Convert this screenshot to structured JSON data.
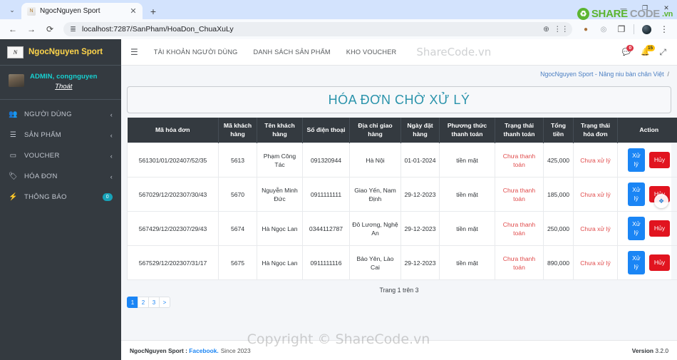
{
  "browser": {
    "tab_title": "NgocNguyen Sport",
    "tab_close": "✕",
    "new_tab": "+",
    "tab_list": "⌄",
    "back": "←",
    "forward": "→",
    "reload": "⟳",
    "url": "localhost:7287/SanPham/HoaDon_ChuaXuLy",
    "site_info_icon": "≣",
    "zoom_icon": "⊕",
    "split_icon": "⋮⋮",
    "cookie_icon": "●",
    "extension_icon": "◌",
    "sidepanel_icon": "❐",
    "menu_icon": "⋮",
    "min": "—",
    "max": "❐",
    "close": "✕"
  },
  "watermark": {
    "logo_glyph": "♻",
    "share": "SHARE",
    "code": "CODE",
    "vn": ".vn",
    "nav_text": "ShareCode.vn",
    "copyright": "Copyright © ShareCode.vn"
  },
  "sidebar": {
    "brand": "NgocNguyen Sport",
    "brand_logo_text": "N",
    "user": {
      "name": "ADMIN, congnguyen",
      "logout": "Thoát"
    },
    "items": [
      {
        "label": "NGƯỜI DÙNG",
        "icon": "👥",
        "chevron": "‹",
        "badge": null
      },
      {
        "label": "SẢN PHẨM",
        "icon": "☰",
        "chevron": "‹",
        "badge": null
      },
      {
        "label": "VOUCHER",
        "icon": "▭",
        "chevron": "‹",
        "badge": null
      },
      {
        "label": "HÓA ĐƠN",
        "icon": "🏷",
        "chevron": "‹",
        "badge": null
      },
      {
        "label": "THÔNG BÁO",
        "icon": "⚡",
        "chevron": null,
        "badge": "0"
      }
    ]
  },
  "navbar": {
    "hamburger": "☰",
    "links": [
      "TÀI KHOẢN NGƯỜI DÙNG",
      "DANH SÁCH SẢN PHẨM",
      "KHO VOUCHER"
    ],
    "chat_icon": "💬",
    "chat_badge": "0",
    "bell_icon": "🔔",
    "bell_badge": "15",
    "expand_icon": "⤢"
  },
  "breadcrumb": {
    "text": "NgocNguyen Sport - Nâng niu bàn chân Việt",
    "separator": "/"
  },
  "page": {
    "title": "HÓA ĐƠN CHỜ XỬ LÝ"
  },
  "table": {
    "columns": [
      "Mã hóa đơn",
      "Mã khách hàng",
      "Tên khách hàng",
      "Số điện thoại",
      "Địa chỉ giao hàng",
      "Ngày đặt hàng",
      "Phương thức thanh toán",
      "Trạng thái thanh toán",
      "Tổng tiền",
      "Trạng thái hóa đơn",
      "Action"
    ],
    "rows": [
      {
        "ma_hoa_don": "561301/01/202407/52/35",
        "ma_khach_hang": "5613",
        "ten_khach_hang": "Phạm Công Tác",
        "so_dien_thoai": "091320944",
        "dia_chi": "Hà Nội",
        "ngay_dat": "01-01-2024",
        "phuong_thuc": "tiền mặt",
        "trang_thai_tt": "Chưa thanh toán",
        "tong_tien": "425,000",
        "trang_thai_hd": "Chưa xử lý",
        "btn_process": "Xử lý",
        "btn_cancel": "Hủy"
      },
      {
        "ma_hoa_don": "567029/12/202307/30/43",
        "ma_khach_hang": "5670",
        "ten_khach_hang": "Nguyễn Minh Đức",
        "so_dien_thoai": "0911111111",
        "dia_chi": "Giao Yến, Nam Định",
        "ngay_dat": "29-12-2023",
        "phuong_thuc": "tiền mặt",
        "trang_thai_tt": "Chưa thanh toán",
        "tong_tien": "185,000",
        "trang_thai_hd": "Chưa xử lý",
        "btn_process": "Xử lý",
        "btn_cancel": "Hủy"
      },
      {
        "ma_hoa_don": "567429/12/202307/29/43",
        "ma_khach_hang": "5674",
        "ten_khach_hang": "Hà Ngọc Lan",
        "so_dien_thoai": "0344112787",
        "dia_chi": "Đô Lương, Nghệ An",
        "ngay_dat": "29-12-2023",
        "phuong_thuc": "tiền mặt",
        "trang_thai_tt": "Chưa thanh toán",
        "tong_tien": "250,000",
        "trang_thai_hd": "Chưa xử lý",
        "btn_process": "Xử lý",
        "btn_cancel": "Hủy"
      },
      {
        "ma_hoa_don": "567529/12/202307/31/17",
        "ma_khach_hang": "5675",
        "ten_khach_hang": "Hà Ngọc Lan",
        "so_dien_thoai": "0911111116",
        "dia_chi": "Bảo Yên, Lào Cai",
        "ngay_dat": "29-12-2023",
        "phuong_thuc": "tiền mặt",
        "trang_thai_tt": "Chưa thanh toán",
        "tong_tien": "890,000",
        "trang_thai_hd": "Chưa xử lý",
        "btn_process": "Xử lý",
        "btn_cancel": "Hủy"
      }
    ]
  },
  "pagination": {
    "info": "Trang 1 trên 3",
    "pages": [
      "1",
      "2",
      "3"
    ],
    "next": ">",
    "active": "1"
  },
  "footer": {
    "brand": "NgocNguyen Sport :",
    "link": "Facebook.",
    "since": "Since 2023",
    "version_label": "Version",
    "version_number": "3.2.0"
  }
}
